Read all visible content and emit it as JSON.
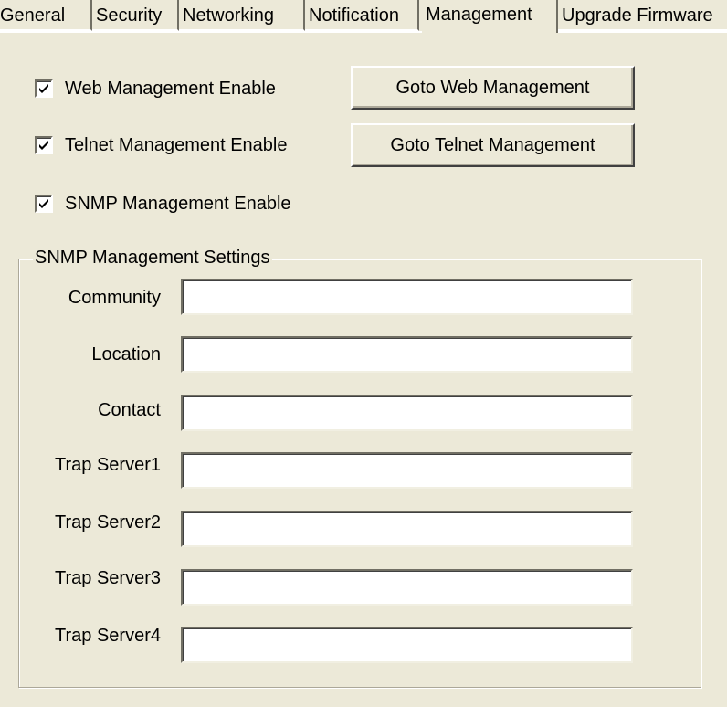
{
  "tabs": [
    {
      "label": "General",
      "active": false
    },
    {
      "label": "Security",
      "active": false
    },
    {
      "label": "Networking",
      "active": false
    },
    {
      "label": "Notification",
      "active": false
    },
    {
      "label": "Management",
      "active": true
    },
    {
      "label": "Upgrade Firmware",
      "active": false
    }
  ],
  "management": {
    "web_enable": {
      "label": "Web Management Enable",
      "checked": true
    },
    "telnet_enable": {
      "label": "Telnet Management Enable",
      "checked": true
    },
    "snmp_enable": {
      "label": "SNMP Management Enable",
      "checked": true
    },
    "goto_web_button": "Goto Web Management",
    "goto_telnet_button": "Goto Telnet Management"
  },
  "snmp_settings": {
    "group_title": "SNMP Management Settings",
    "fields": [
      {
        "label": "Community",
        "value": ""
      },
      {
        "label": "Location",
        "value": ""
      },
      {
        "label": "Contact",
        "value": ""
      },
      {
        "label": "Trap Server1",
        "value": ""
      },
      {
        "label": "Trap Server2",
        "value": ""
      },
      {
        "label": "Trap Server3",
        "value": ""
      },
      {
        "label": "Trap Server4",
        "value": ""
      }
    ]
  },
  "colors": {
    "background": "#ece9d8",
    "border_dark": "#716f64",
    "border_light": "#ffffff",
    "groupbox_border": "#aca899"
  },
  "icons": {
    "checkmark": "checkmark-icon"
  }
}
